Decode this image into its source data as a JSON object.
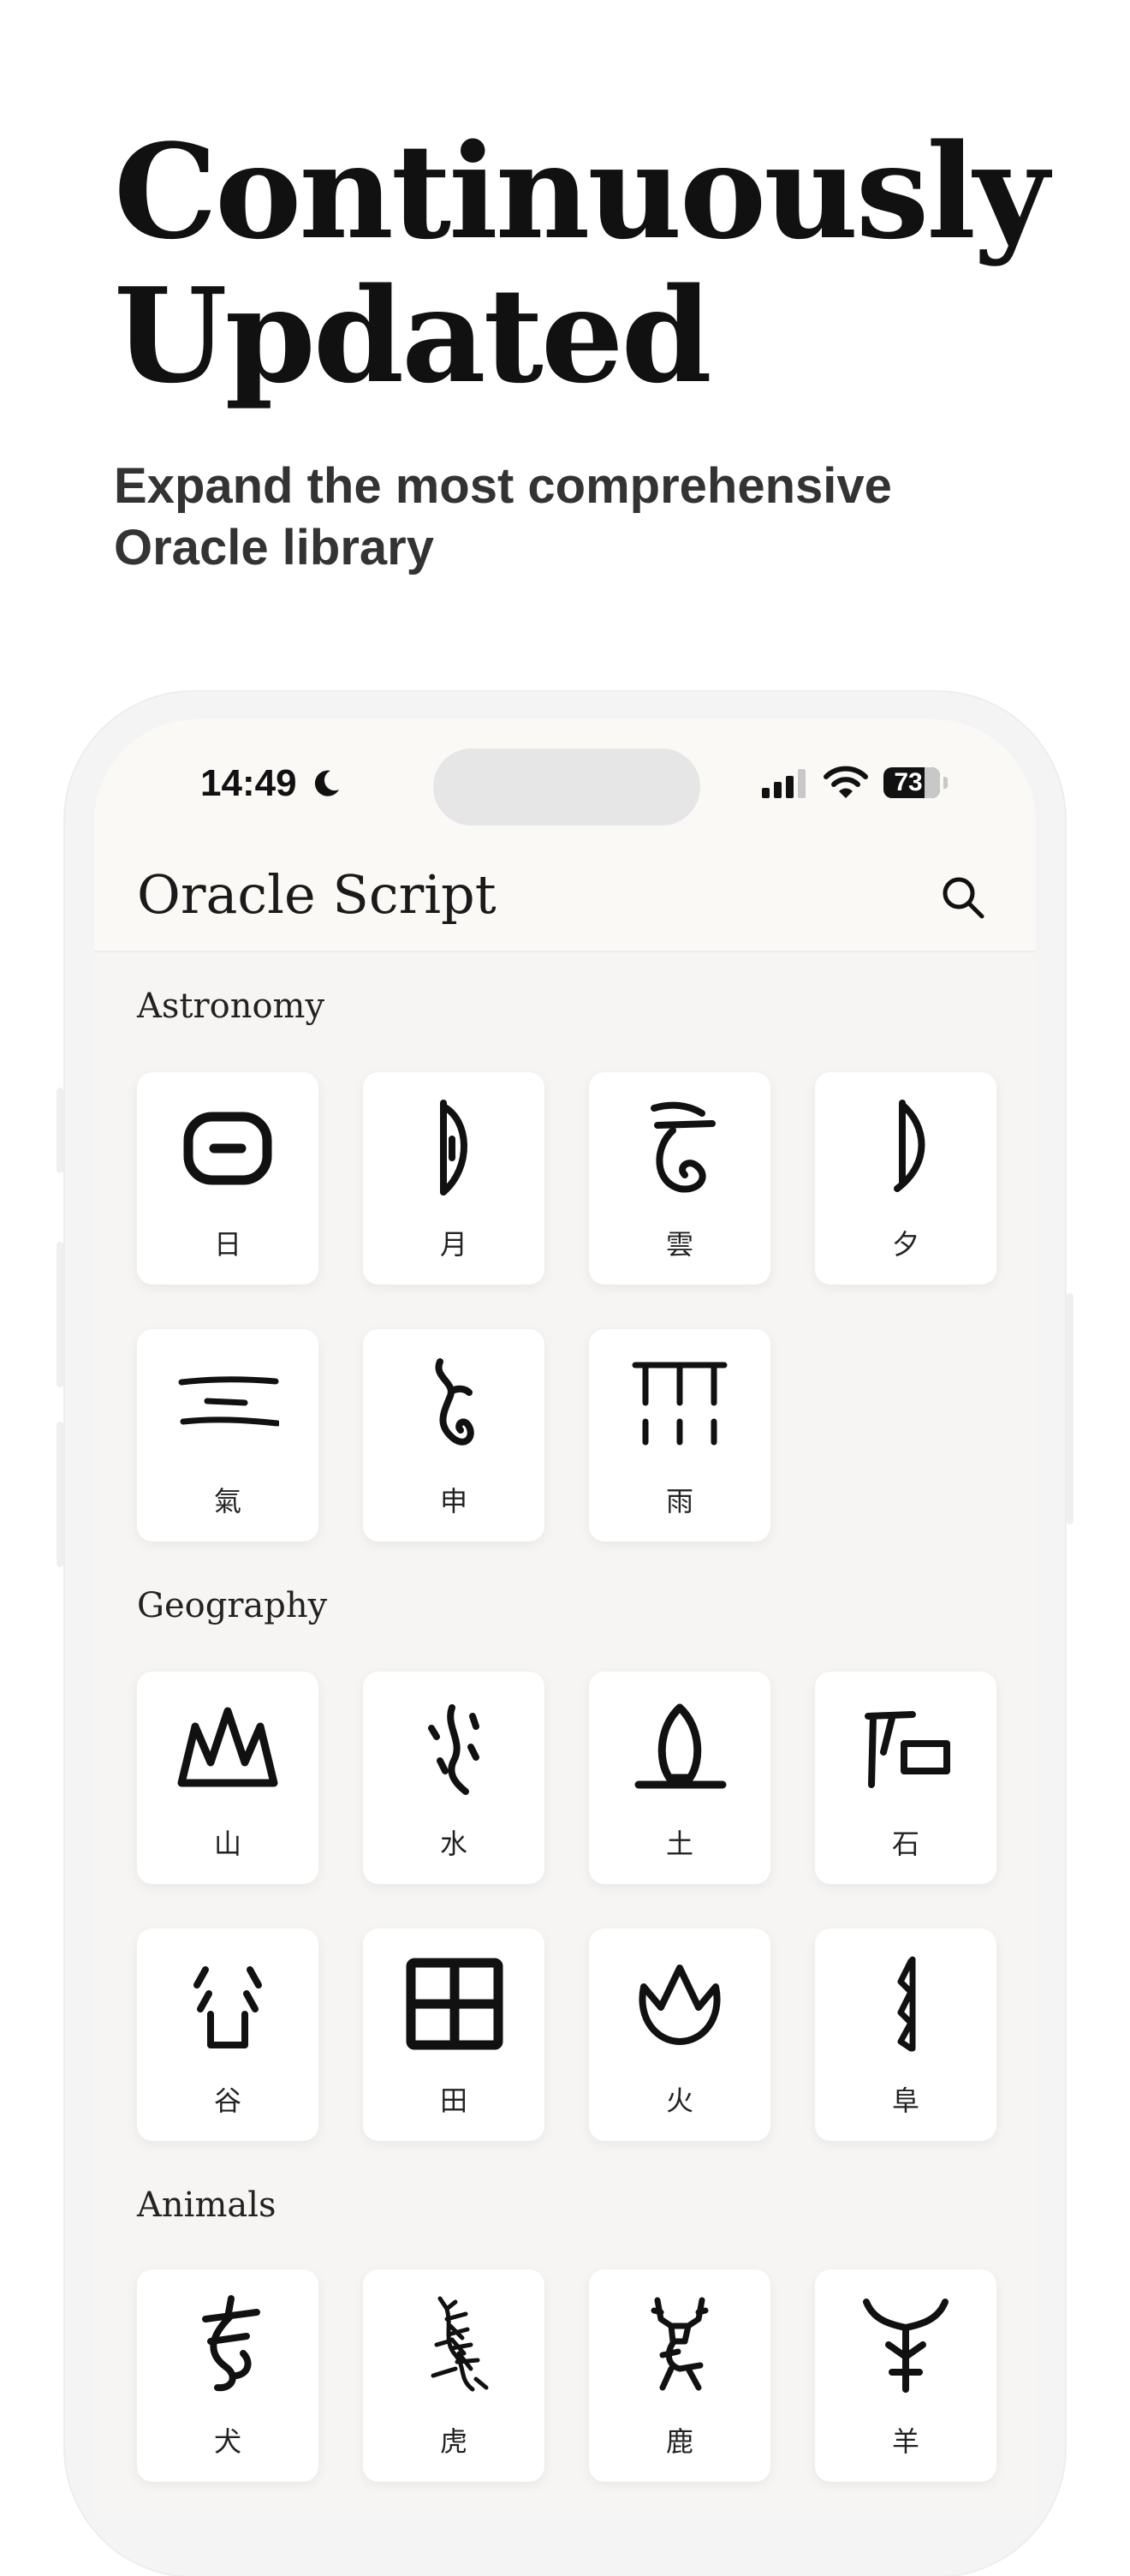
{
  "hero": {
    "title_line1": "Continuously",
    "title_line2": "Updated",
    "subtitle_line1": "Expand the most comprehensive",
    "subtitle_line2": "Oracle library"
  },
  "status_bar": {
    "time": "14:49",
    "battery": "73",
    "icons": [
      "moon-icon",
      "signal-icon",
      "wifi-icon",
      "battery-icon"
    ]
  },
  "app": {
    "title": "Oracle Script",
    "search_icon": "search-icon"
  },
  "sections": [
    {
      "title": "Astronomy",
      "items": [
        "日",
        "月",
        "雲",
        "夕",
        "氣",
        "申",
        "雨"
      ]
    },
    {
      "title": "Geography",
      "items": [
        "山",
        "水",
        "土",
        "石",
        "谷",
        "田",
        "火",
        "阜"
      ]
    },
    {
      "title": "Animals",
      "items": [
        "犬",
        "虎",
        "鹿",
        "羊"
      ]
    }
  ],
  "colors": {
    "background": "#ffffff",
    "screen": "#faf9f6",
    "card": "#ffffff",
    "ink": "#111111"
  }
}
